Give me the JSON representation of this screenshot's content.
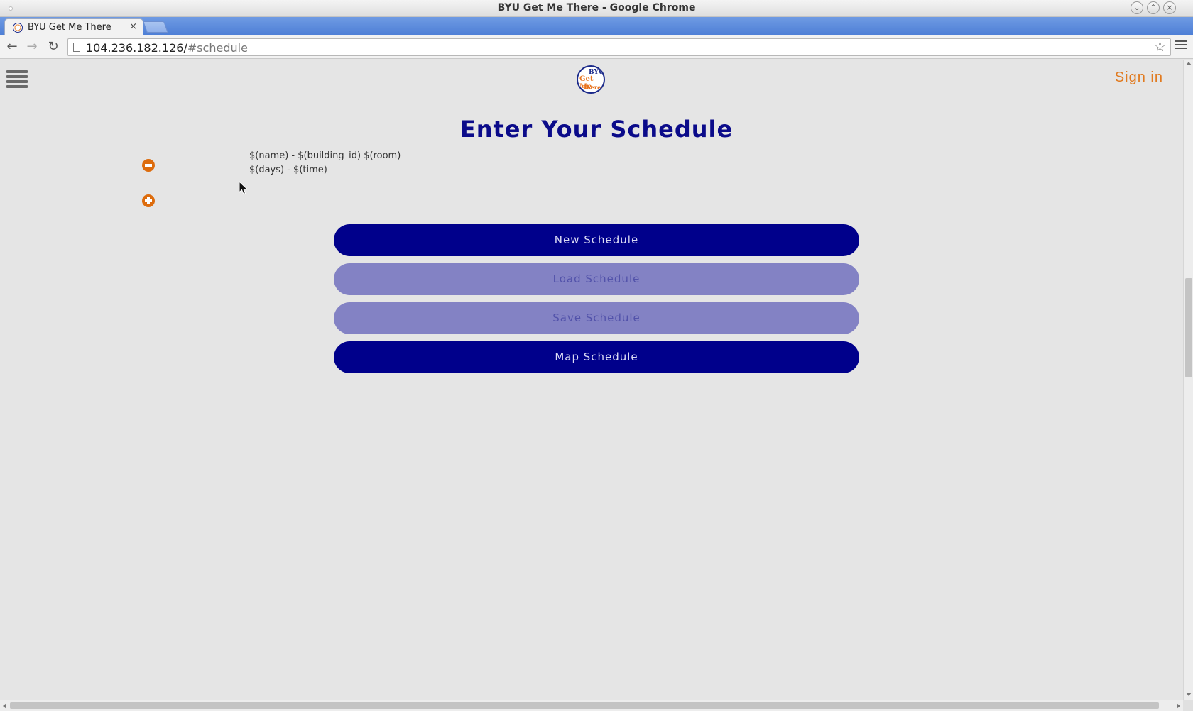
{
  "window": {
    "title": "BYU Get Me There - Google Chrome"
  },
  "tabs": [
    {
      "label": "BYU Get Me There",
      "close": "×"
    }
  ],
  "toolbar": {
    "back_icon": "←",
    "forward_icon": "→",
    "reload_icon": "↻",
    "url_host": "104.236.182.126/",
    "url_path": "#schedule",
    "star_icon": "☆"
  },
  "header": {
    "logo": {
      "line1": "BYU",
      "line2": "Get Me",
      "line3": "There"
    },
    "sign_in": "Sign in"
  },
  "main": {
    "title": "Enter Your Schedule",
    "class_entry": {
      "line1": "$(name) - $(building_id) $(room)",
      "line2": "$(days) - $(time)"
    },
    "buttons": {
      "new": "New Schedule",
      "load": "Load Schedule",
      "save": "Save Schedule",
      "map": "Map Schedule"
    }
  },
  "colors": {
    "primary": "#00008b",
    "primary_disabled": "#8382c4",
    "accent": "#e17a1f",
    "background": "#e5e5e5"
  }
}
